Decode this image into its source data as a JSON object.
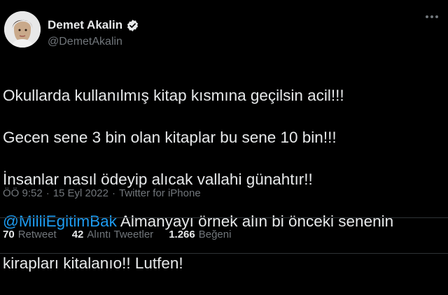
{
  "author": {
    "display_name": "Demet Akalin",
    "handle": "@DemetAkalin",
    "verified_icon": "verified-badge-icon",
    "avatar_icon": "profile-photo"
  },
  "tweet": {
    "line1": "Okullarda kullanılmış kitap kısmına geçilsin acil!!!",
    "line2": "Gecen sene 3 bin olan kitaplar bu sene 10 bin!!!",
    "line3": "İnsanlar nasıl ödeyip alıcak vallahi günahtır!!",
    "mention": "@MilliEgitimBak",
    "line4_rest": " Almanyayı örnek alın bi önceki senenin",
    "line5": "kirapları kitalanıo!! Lutfen!"
  },
  "meta": {
    "time": "ÖÖ 9:52",
    "sep1": "·",
    "date": "15 Eyl 2022",
    "sep2": "·",
    "source": "Twitter for iPhone"
  },
  "stats": {
    "retweets_count": "70",
    "retweets_label": "Retweet",
    "quotes_count": "42",
    "quotes_label": "Alıntı Tweetler",
    "likes_count": "1.266",
    "likes_label": "Beğeni"
  },
  "colors": {
    "background": "#000000",
    "text": "#e7e9ea",
    "secondary": "#71767b",
    "accent": "#1d9bf0"
  }
}
